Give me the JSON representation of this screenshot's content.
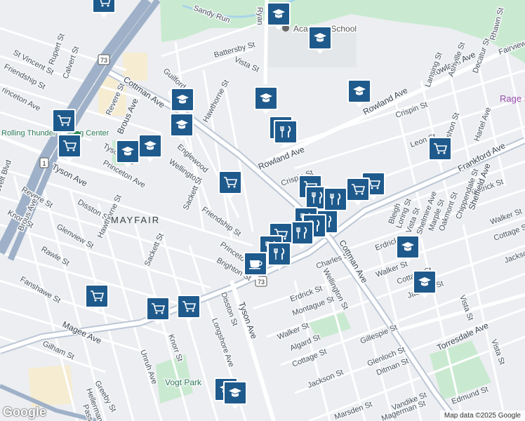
{
  "map": {
    "area_label": "MAYFAIR",
    "logo": "Google",
    "attribution": "Map data ©2025 Google",
    "colors": {
      "school": "#1f5a8c",
      "store": "#1f5a8c",
      "restaurant": "#1f5a8c",
      "cafe": "#1f5a8c",
      "park": "#c9ead0",
      "land": "#eceef1"
    },
    "streets": [
      "Sandy Run",
      "Ryan",
      "Battersby St",
      "Vista St",
      "Rupert St",
      "Calvert St",
      "Friendship St",
      "St Vincent St",
      "rinceton Ave",
      "Cottman Ave",
      "Revere St",
      "Brous Ave",
      "Guilford St",
      "Hawthorne St",
      "Englewood",
      "Wellington",
      "Princeton Ave",
      "Sackett St",
      "Rowland Ave",
      "Crispin St",
      "Lansing St",
      "Ashville St",
      "Decatur St",
      "Rhawn St",
      "Fairview",
      "Leon St",
      "Mershon St",
      "Hartel Ave",
      "Erdrick St",
      "Frankford Ave",
      "Sheffield Ave",
      "Walker St",
      "Cottage St",
      "Jackson St",
      "Chippendale St",
      "Oakmont St",
      "Marple St",
      "Shelmire Ave",
      "Vista St",
      "Loring St",
      "Bleigh",
      "Tyson Ave",
      "Disston St",
      "Knorr St",
      "Glenview St",
      "Rawle St",
      "Fanshawe St",
      "Magee Ave",
      "Gilham St",
      "Unruh Ave",
      "Longshore Ave",
      "Greeby St",
      "Hellerman",
      "Pass",
      "Brighton St",
      "Charles St",
      "Wellington St",
      "Montague St",
      "Walker St",
      "Algard St",
      "Cottage St",
      "Gillespie St",
      "Glenloch St",
      "Ditman St",
      "Jackson St",
      "Torresdale Ave",
      "Edmund St",
      "Vandike St",
      "Marsden St",
      "Magerman St",
      "Vista St",
      "Vista St",
      "Vogt Park",
      "Friendship St",
      "Princeto",
      "Revere St",
      "Knorr St",
      "Disston St",
      "evelt Blvd",
      "Tyson Ave",
      "Hawthorne St",
      "Roosevelt Ave",
      "Erdrick St",
      "Walker St"
    ],
    "places": {
      "school": "Academy School",
      "rink": "Rolling Thunder Skating Center",
      "biz": "Rage R",
      "park": "Vogt Park"
    },
    "route_shields": [
      "73",
      "1",
      "73"
    ]
  }
}
